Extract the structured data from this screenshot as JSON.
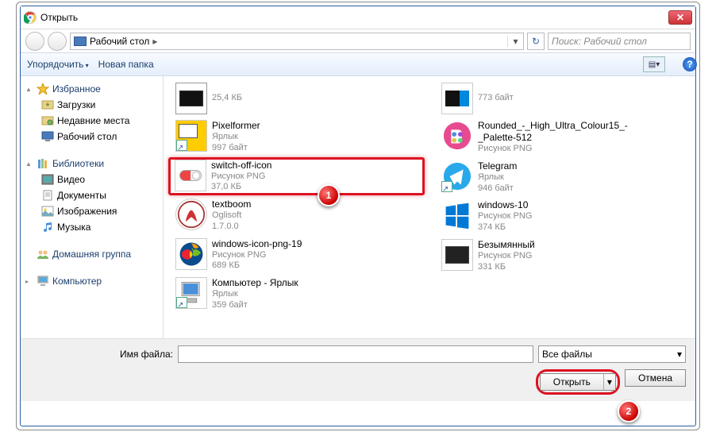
{
  "window": {
    "title": "Открыть",
    "close_x": "✕"
  },
  "nav": {
    "location": "Рабочий стол",
    "arrow": "▸",
    "dropdown": "▾",
    "refresh": "↻",
    "search_placeholder": "Поиск: Рабочий стол"
  },
  "toolbar": {
    "organize": "Упорядочить",
    "newfolder": "Новая папка",
    "help": "?"
  },
  "sidebar": {
    "fav": {
      "label": "Избранное",
      "items": [
        {
          "label": "Загрузки"
        },
        {
          "label": "Недавние места"
        },
        {
          "label": "Рабочий стол"
        }
      ]
    },
    "lib": {
      "label": "Библиотеки",
      "items": [
        {
          "label": "Видео"
        },
        {
          "label": "Документы"
        },
        {
          "label": "Изображения"
        },
        {
          "label": "Музыка"
        }
      ]
    },
    "home": {
      "label": "Домашняя группа"
    },
    "comp": {
      "label": "Компьютер"
    }
  },
  "files": {
    "left": [
      {
        "line2": "25,4 КБ"
      },
      {
        "line1": "Pixelformer",
        "line2": "Ярлык",
        "line3": "997 байт"
      },
      {
        "line1": "switch-off-icon",
        "line2": "Рисунок PNG",
        "line3": "37,0 КБ",
        "selected": true
      },
      {
        "line1": "textboom",
        "line2": "Oglisoft",
        "line3": "1.7.0.0"
      },
      {
        "line1": "windows-icon-png-19",
        "line2": "Рисунок PNG",
        "line3": "689 КБ"
      },
      {
        "line1": "Компьютер - Ярлык",
        "line2": "Ярлык",
        "line3": "359 байт"
      }
    ],
    "right": [
      {
        "line2": "773 байт"
      },
      {
        "line1": "Rounded_-_High_Ultra_Colour15_-_Palette-512",
        "line2": "Рисунок PNG"
      },
      {
        "line1": "Telegram",
        "line2": "Ярлык",
        "line3": "946 байт"
      },
      {
        "line1": "windows-10",
        "line2": "Рисунок PNG",
        "line3": "374 КБ"
      },
      {
        "line1": "Безымянный",
        "line2": "Рисунок PNG",
        "line3": "331 КБ"
      }
    ]
  },
  "bottom": {
    "filename_label": "Имя файла:",
    "filter": "Все файлы",
    "open": "Открыть",
    "cancel": "Отмена"
  },
  "callouts": {
    "one": "1",
    "two": "2"
  }
}
